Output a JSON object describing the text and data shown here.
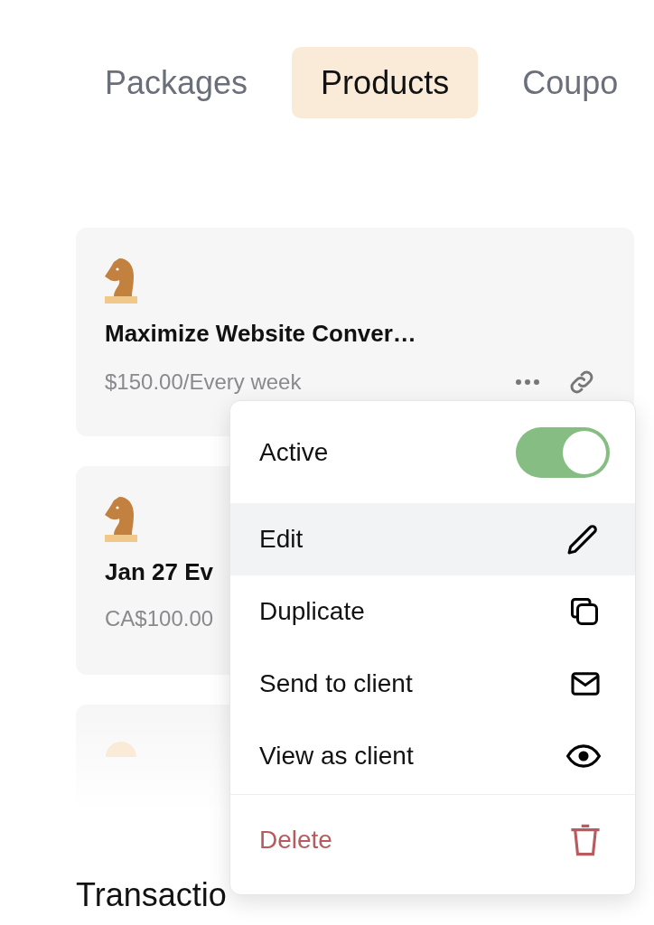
{
  "tabs": [
    {
      "label": "Packages",
      "selected": false
    },
    {
      "label": "Products",
      "selected": true
    },
    {
      "label": "Coupo",
      "selected": false
    }
  ],
  "products": [
    {
      "title": "Maximize Website Conver…",
      "price": "$150.00/Every week",
      "show_actions": true,
      "faded": false
    },
    {
      "title": "Jan 27 Ev",
      "price": "CA$100.00",
      "show_actions": false,
      "faded": false
    },
    {
      "faded": true,
      "show_actions": false
    }
  ],
  "menu": {
    "items": [
      {
        "kind": "toggle",
        "label": "Active",
        "on": true,
        "selected": false
      },
      {
        "kind": "edit",
        "label": "Edit",
        "selected": true
      },
      {
        "kind": "duplicate",
        "label": "Duplicate",
        "selected": false
      },
      {
        "kind": "send",
        "label": "Send to client",
        "selected": false
      },
      {
        "kind": "view",
        "label": "View as client",
        "selected": false
      },
      {
        "kind": "delete",
        "label": "Delete",
        "selected": false
      }
    ]
  },
  "section_title": "Transactio"
}
